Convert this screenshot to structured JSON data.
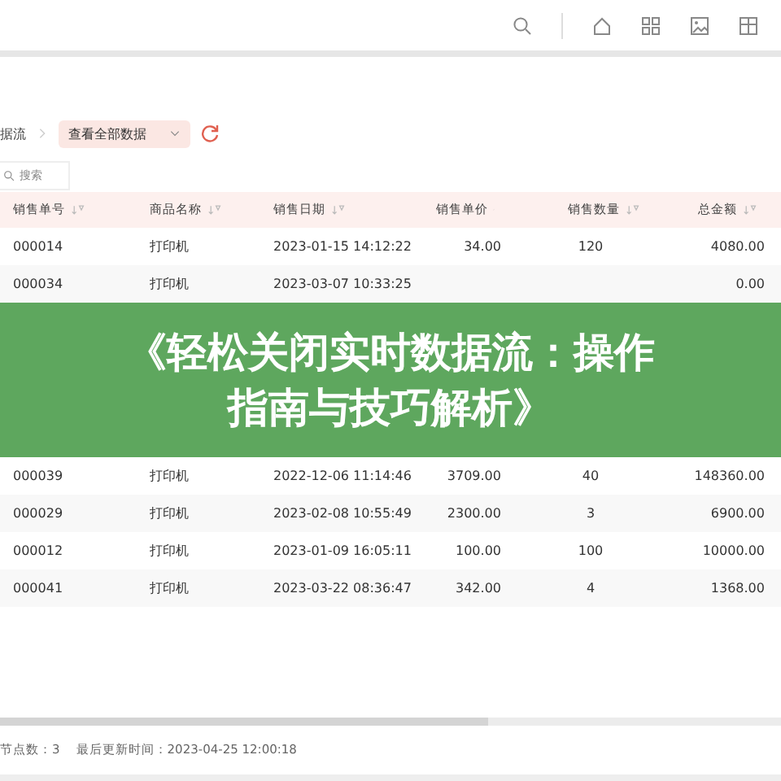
{
  "breadcrumb": {
    "parent": "据流",
    "view": "查看全部数据"
  },
  "search": {
    "placeholder": "搜索"
  },
  "table": {
    "columns": [
      "销售单号",
      "商品名称",
      "销售日期",
      "销售单价",
      "销售数量",
      "总金额"
    ],
    "rows": [
      [
        "000014",
        "打印机",
        "2023-01-15 14:12:22",
        "34.00",
        "120",
        "4080.00"
      ],
      [
        "000034",
        "打印机",
        "2023-03-07 10:33:25",
        null,
        null,
        "0.00"
      ],
      [
        "000039",
        "打印机",
        "2022-12-06 11:14:46",
        "3709.00",
        "40",
        "148360.00"
      ],
      [
        "000029",
        "打印机",
        "2023-02-08 10:55:49",
        "2300.00",
        "3",
        "6900.00"
      ],
      [
        "000012",
        "打印机",
        "2023-01-09 16:05:11",
        "100.00",
        "100",
        "10000.00"
      ],
      [
        "000041",
        "打印机",
        "2023-03-22 08:36:47",
        "342.00",
        "4",
        "1368.00"
      ]
    ]
  },
  "banner": {
    "lines": [
      "《轻松关闭实时数据流：操作",
      "指南与技巧解析》"
    ]
  },
  "status_bar": [
    "节点数：3",
    "最后更新时间：2023-04-25 12:00:18"
  ]
}
